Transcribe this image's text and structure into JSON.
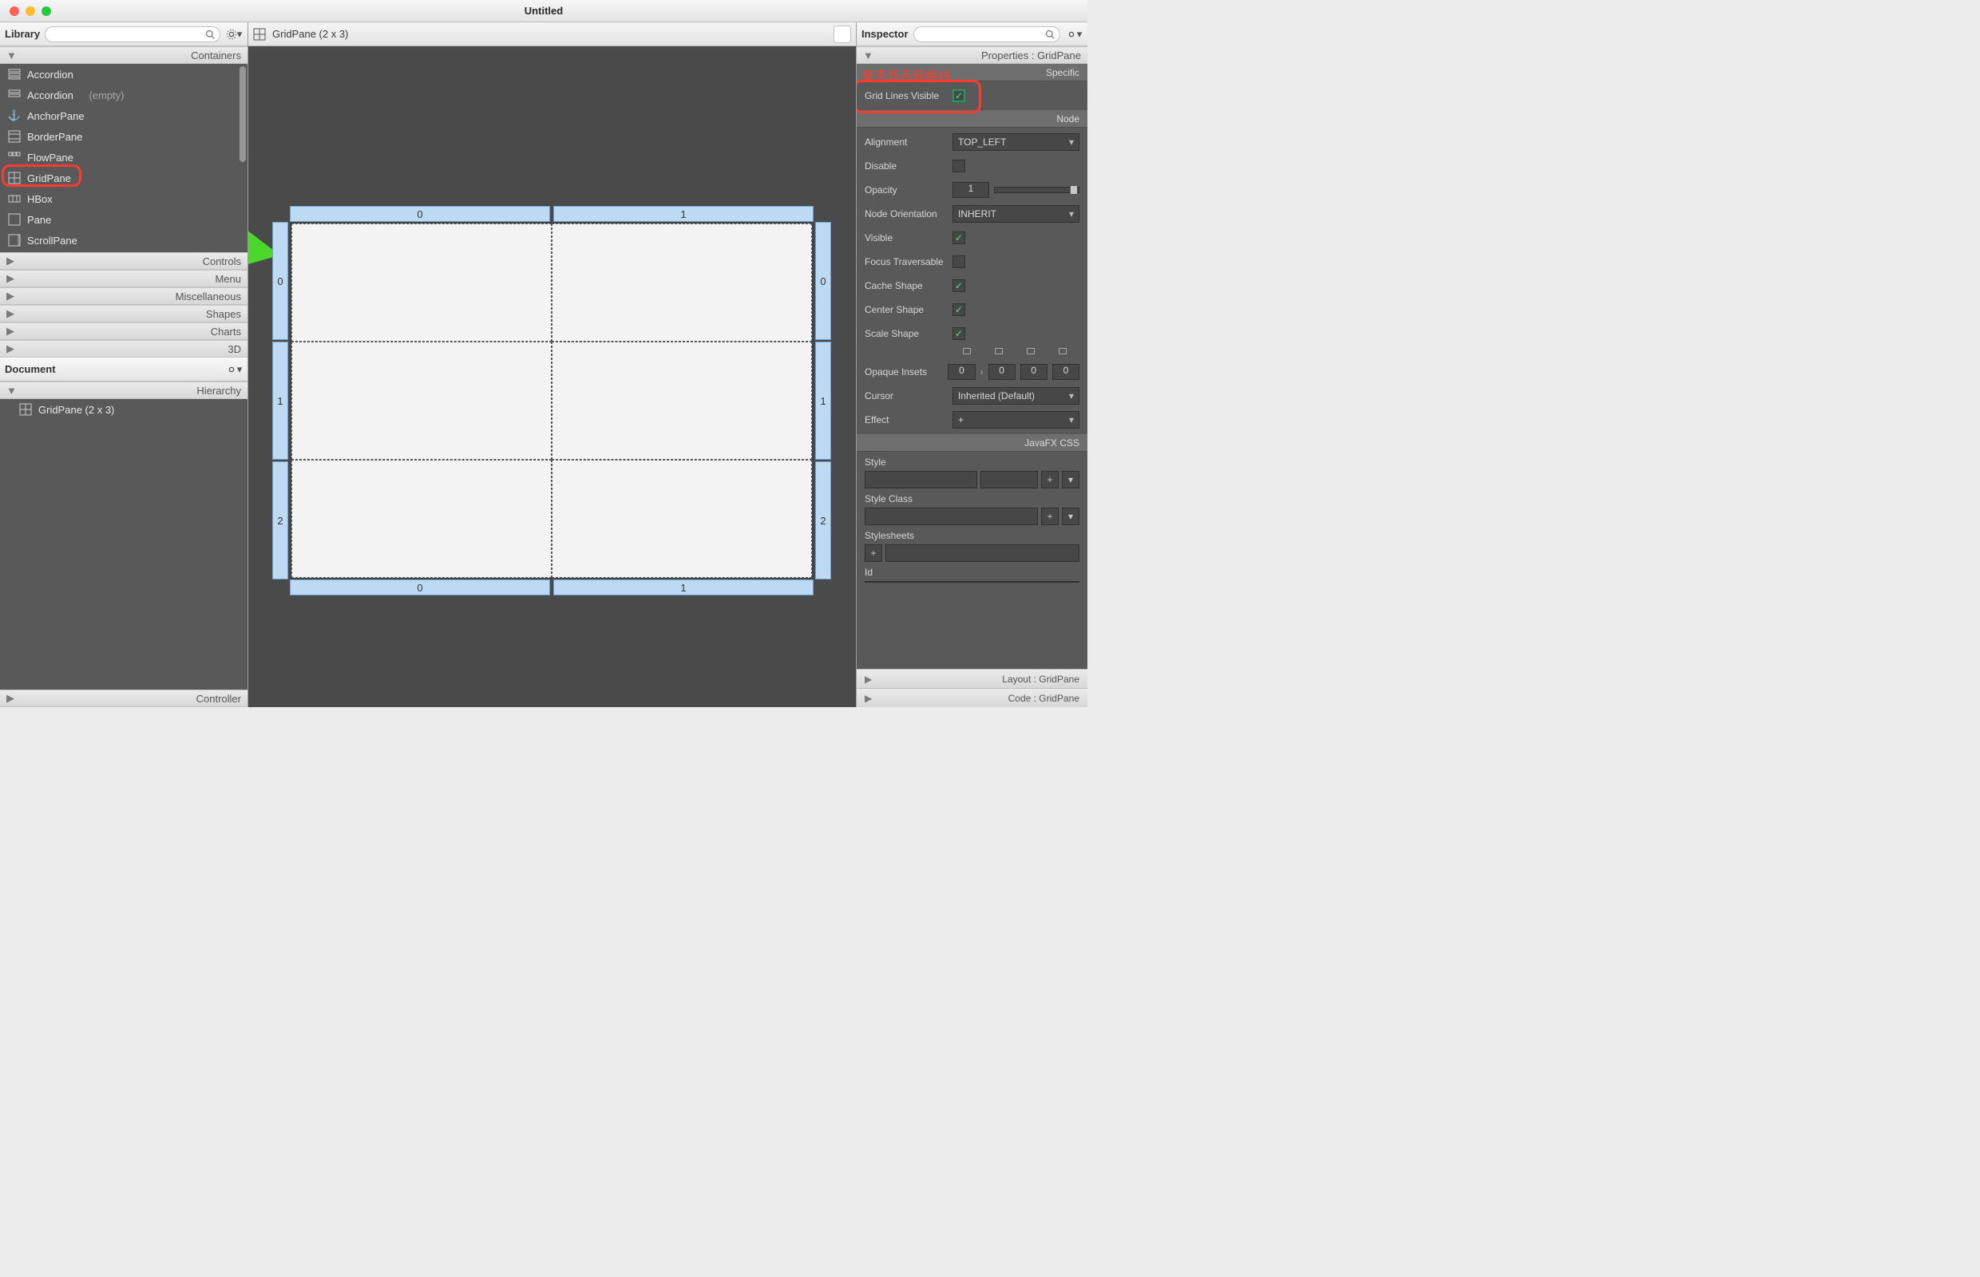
{
  "window": {
    "title": "Untitled"
  },
  "library": {
    "title": "Library",
    "sections": {
      "containers": "Containers",
      "controls": "Controls",
      "menu": "Menu",
      "misc": "Miscellaneous",
      "shapes": "Shapes",
      "charts": "Charts",
      "threeD": "3D"
    },
    "items": [
      {
        "label": "Accordion",
        "suffix": ""
      },
      {
        "label": "Accordion",
        "suffix": "(empty)"
      },
      {
        "label": "AnchorPane",
        "suffix": ""
      },
      {
        "label": "BorderPane",
        "suffix": ""
      },
      {
        "label": "FlowPane",
        "suffix": ""
      },
      {
        "label": "GridPane",
        "suffix": ""
      },
      {
        "label": "HBox",
        "suffix": ""
      },
      {
        "label": "Pane",
        "suffix": ""
      },
      {
        "label": "ScrollPane",
        "suffix": ""
      }
    ]
  },
  "document": {
    "title": "Document",
    "hierarchyLabel": "Hierarchy",
    "root": "GridPane (2 x 3)",
    "controllerLabel": "Controller"
  },
  "breadcrumb": {
    "label": "GridPane (2 x 3)"
  },
  "grid": {
    "cols": [
      "0",
      "1"
    ],
    "rows": [
      "0",
      "1",
      "2"
    ]
  },
  "inspector": {
    "title": "Inspector",
    "propertiesHeader": "Properties : GridPane",
    "layoutHeader": "Layout : GridPane",
    "codeHeader": "Code : GridPane",
    "groups": {
      "specific": "Specific",
      "node": "Node",
      "javafxcss": "JavaFX CSS"
    },
    "props": {
      "gridLinesVisible": "Grid Lines Visible",
      "alignment": {
        "label": "Alignment",
        "value": "TOP_LEFT"
      },
      "disable": "Disable",
      "opacity": {
        "label": "Opacity",
        "value": "1"
      },
      "nodeOrientation": {
        "label": "Node Orientation",
        "value": "INHERIT"
      },
      "visible": "Visible",
      "focusTraversable": "Focus Traversable",
      "cacheShape": "Cache Shape",
      "centerShape": "Center Shape",
      "scaleShape": "Scale Shape",
      "opaqueInsets": {
        "label": "Opaque Insets",
        "t": "0",
        "r": "0",
        "b": "0",
        "l": "0"
      },
      "cursor": {
        "label": "Cursor",
        "value": "Inherited (Default)"
      },
      "effect": {
        "label": "Effect",
        "value": "+"
      },
      "style": "Style",
      "styleClass": "Style Class",
      "stylesheets": "Stylesheets",
      "id": "Id"
    }
  },
  "annotations": {
    "gridLinesNote": "是否显示网格线"
  }
}
